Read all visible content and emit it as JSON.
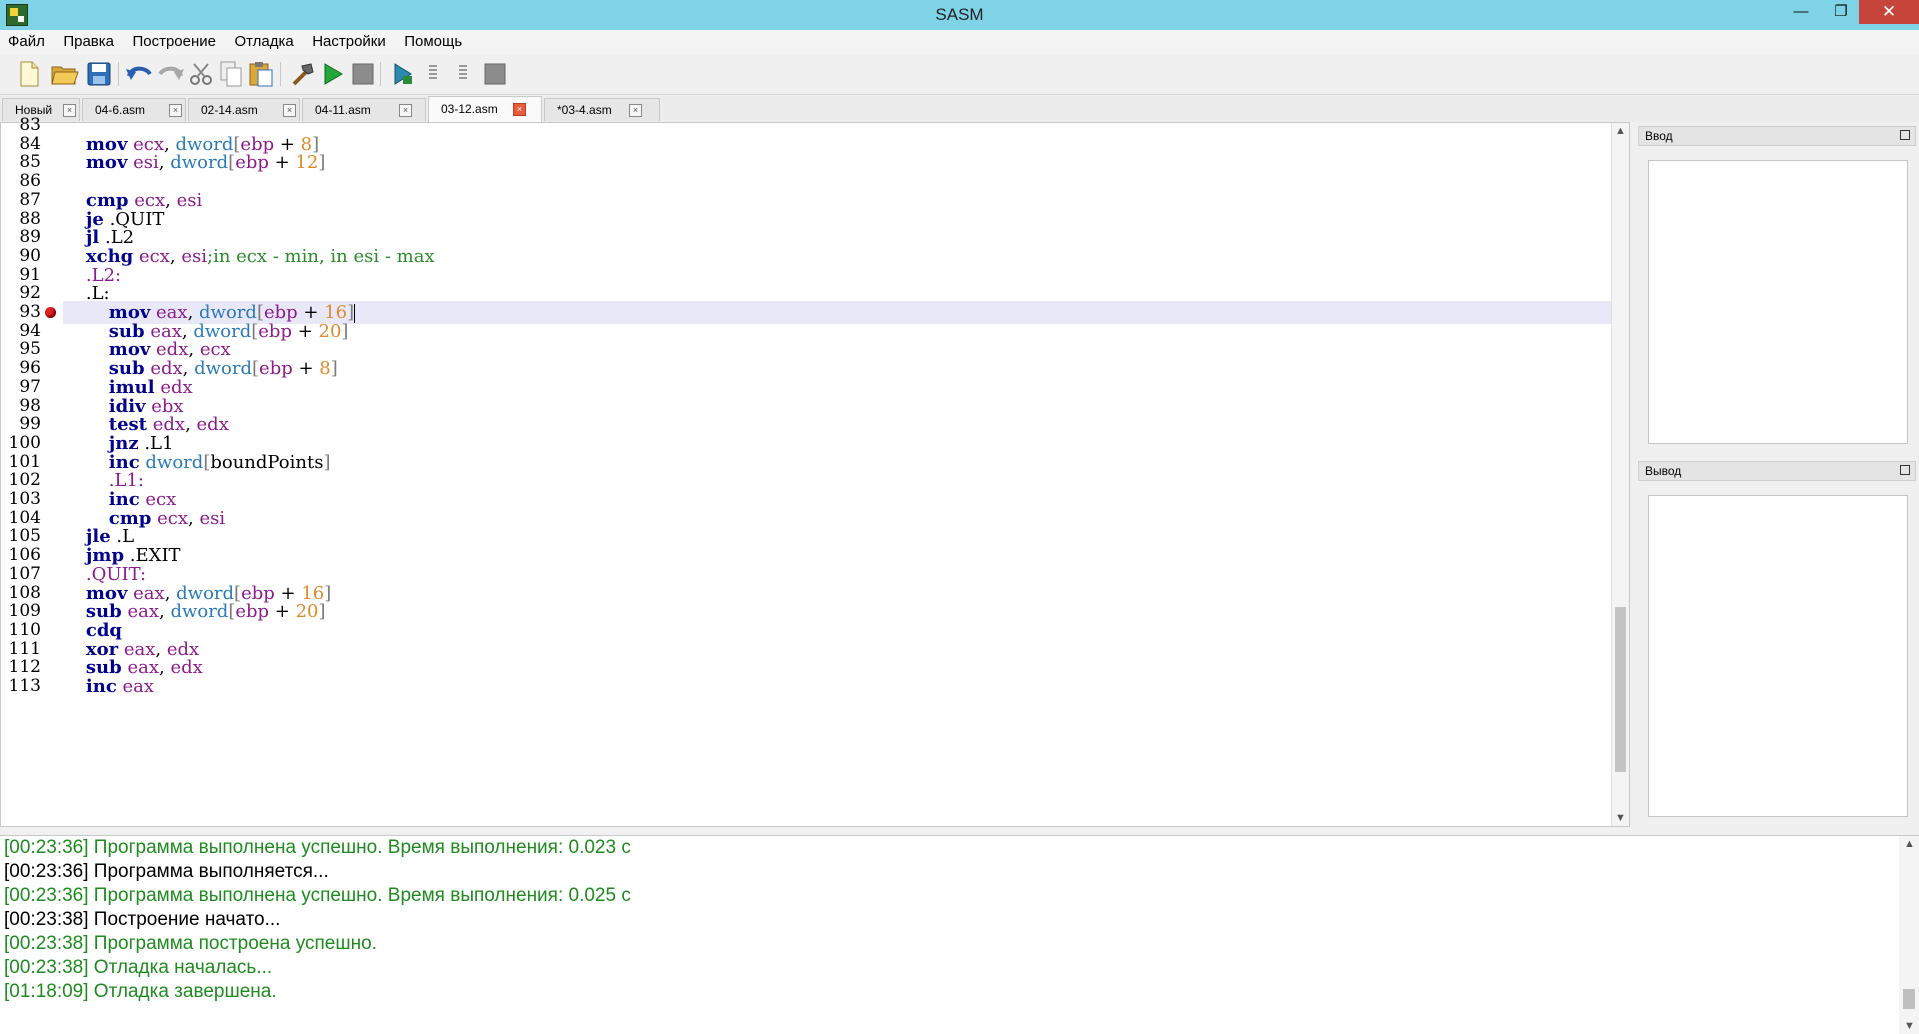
{
  "window": {
    "title": "SASM",
    "minimize": "—",
    "maximize": "❐",
    "close": "✕"
  },
  "menu": [
    "Файл",
    "Правка",
    "Построение",
    "Отладка",
    "Настройки",
    "Помощь"
  ],
  "toolbar": {
    "icons": [
      "new-file-icon",
      "open-file-icon",
      "save-icon",
      "undo-icon",
      "redo-icon",
      "cut-icon",
      "copy-icon",
      "paste-icon",
      "build-icon",
      "run-icon",
      "stop-icon",
      "debug-run-icon",
      "step-into-icon",
      "step-over-icon",
      "debug-stop-icon"
    ]
  },
  "tabs": [
    {
      "label": "Новый",
      "active": false
    },
    {
      "label": "04-6.asm",
      "active": false
    },
    {
      "label": "02-14.asm",
      "active": false
    },
    {
      "label": "04-11.asm",
      "active": false
    },
    {
      "label": "03-12.asm",
      "active": true
    },
    {
      "label": "*03-4.asm",
      "active": false
    }
  ],
  "editor": {
    "current_line": 93,
    "breakpoint_line": 93,
    "lines": [
      {
        "n": "83",
        "code": ""
      },
      {
        "n": "84",
        "code": "    <k>mov</k> <r>ecx</r>, <t>dword</t><b>[</b><r>ebp</r> + <u>8</u><b>]</b>"
      },
      {
        "n": "85",
        "code": "    <k>mov</k> <r>esi</r>, <t>dword</t><b>[</b><r>ebp</r> + <u>12</u><b>]</b>"
      },
      {
        "n": "86",
        "code": ""
      },
      {
        "n": "87",
        "code": "    <k>cmp</k> <r>ecx</r>, <r>esi</r>"
      },
      {
        "n": "88",
        "code": "    <k>je</k> .QUIT"
      },
      {
        "n": "89",
        "code": "    <k>jl</k> .L2"
      },
      {
        "n": "90",
        "code": "    <k>xchg</k> <r>ecx</r>, <r>esi</r><c>;in ecx - min, in esi - max</c>"
      },
      {
        "n": "91",
        "code": "    <r>.L2:</r>"
      },
      {
        "n": "92",
        "code": "    .L:"
      },
      {
        "n": "93",
        "code": "        <k>mov</k> <r>eax</r>, <t>dword</t><b>[</b><r>ebp</r> + <u>16</u><b>]</b>"
      },
      {
        "n": "94",
        "code": "        <k>sub</k> <r>eax</r>, <t>dword</t><b>[</b><r>ebp</r> + <u>20</u><b>]</b>"
      },
      {
        "n": "95",
        "code": "        <k>mov</k> <r>edx</r>, <r>ecx</r>"
      },
      {
        "n": "96",
        "code": "        <k>sub</k> <r>edx</r>, <t>dword</t><b>[</b><r>ebp</r> + <u>8</u><b>]</b>"
      },
      {
        "n": "97",
        "code": "        <k>imul</k> <r>edx</r>"
      },
      {
        "n": "98",
        "code": "        <k>idiv</k> <r>ebx</r>"
      },
      {
        "n": "99",
        "code": "        <k>test</k> <r>edx</r>, <r>edx</r>"
      },
      {
        "n": "100",
        "code": "        <k>jnz</k> .L1"
      },
      {
        "n": "101",
        "code": "        <k>inc</k> <t>dword</t><b>[</b>boundPoints<b>]</b>"
      },
      {
        "n": "102",
        "code": "        <r>.L1:</r>"
      },
      {
        "n": "103",
        "code": "        <k>inc</k> <r>ecx</r>"
      },
      {
        "n": "104",
        "code": "        <k>cmp</k> <r>ecx</r>, <r>esi</r>"
      },
      {
        "n": "105",
        "code": "    <k>jle</k> .L"
      },
      {
        "n": "106",
        "code": "    <k>jmp</k> .EXIT"
      },
      {
        "n": "107",
        "code": "    <r>.QUIT:</r>"
      },
      {
        "n": "108",
        "code": "    <k>mov</k> <r>eax</r>, <t>dword</t><b>[</b><r>ebp</r> + <u>16</u><b>]</b>"
      },
      {
        "n": "109",
        "code": "    <k>sub</k> <r>eax</r>, <t>dword</t><b>[</b><r>ebp</r> + <u>20</u><b>]</b>"
      },
      {
        "n": "110",
        "code": "    <k>cdq</k>"
      },
      {
        "n": "111",
        "code": "    <k>xor</k> <r>eax</r>, <r>edx</r>"
      },
      {
        "n": "112",
        "code": "    <k>sub</k> <r>eax</r>, <r>edx</r>"
      },
      {
        "n": "113",
        "code": "    <k>inc</k> <r>eax</r>"
      }
    ]
  },
  "panels": {
    "input_title": "Ввод",
    "output_title": "Вывод"
  },
  "log": [
    {
      "text": "[00:23:36] Программа выполнена успешно. Время выполнения: 0.023 с",
      "ok": true
    },
    {
      "text": "[00:23:36] Программа выполняется...",
      "ok": false
    },
    {
      "text": "[00:23:36] Программа выполнена успешно. Время выполнения: 0.025 с",
      "ok": true
    },
    {
      "text": "[00:23:38] Построение начато...",
      "ok": false
    },
    {
      "text": "[00:23:38] Программа построена успешно.",
      "ok": true
    },
    {
      "text": "[00:23:38] Отладка началась...",
      "ok": true
    },
    {
      "text": "[01:18:09] Отладка завершена.",
      "ok": true
    }
  ],
  "colors": {
    "titlebar": "#7fd3e6",
    "keyword": "#00008b",
    "register": "#8b1a8b",
    "type": "#2a7ab8",
    "number": "#e08a2c",
    "comment": "#2b8a2b",
    "log_ok": "#1f8a1f",
    "current_line": "#e8e8f8"
  }
}
